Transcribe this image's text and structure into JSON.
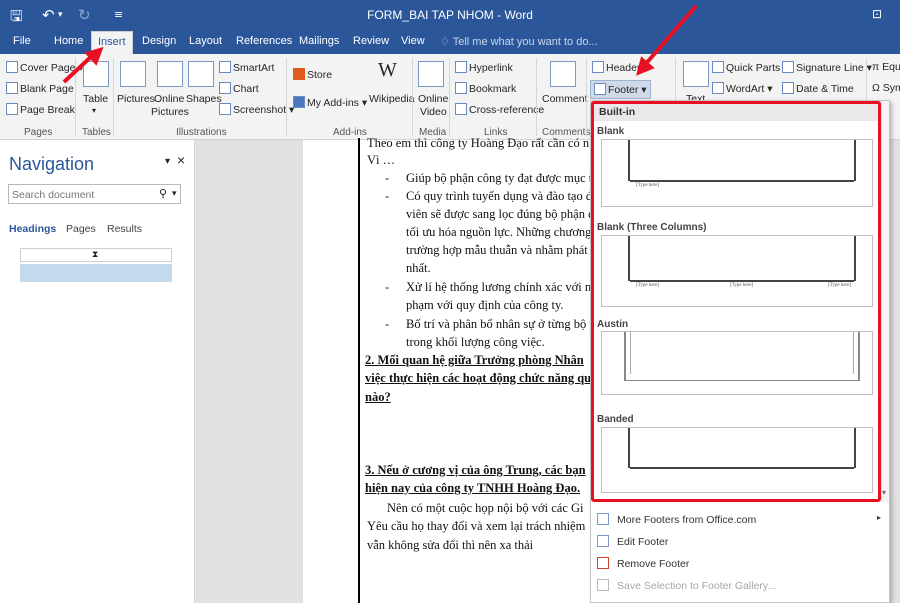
{
  "window": {
    "title": "FORM_BAI TAP NHOM - Word"
  },
  "ribbon_tabs": [
    "File",
    "Home",
    "Insert",
    "Design",
    "Layout",
    "References",
    "Mailings",
    "Review",
    "View"
  ],
  "tell_me": "Tell me what you want to do...",
  "ribbon": {
    "pages": {
      "cover_page": "Cover Page",
      "blank_page": "Blank Page",
      "page_break": "Page Break",
      "group": "Pages"
    },
    "tables": {
      "table": "Table",
      "group": "Tables"
    },
    "illustrations": {
      "pictures": "Pictures",
      "online_pictures_1": "Online",
      "online_pictures_2": "Pictures",
      "shapes": "Shapes",
      "smartart": "SmartArt",
      "chart": "Chart",
      "screenshot": "Screenshot",
      "group": "Illustrations"
    },
    "addins": {
      "store": "Store",
      "my_addins": "My Add-ins",
      "wikipedia": "Wikipedia",
      "group": "Add-ins"
    },
    "media": {
      "online_video_1": "Online",
      "online_video_2": "Video",
      "group": "Media"
    },
    "links": {
      "hyperlink": "Hyperlink",
      "bookmark": "Bookmark",
      "cross_reference": "Cross-reference",
      "group": "Links"
    },
    "comments": {
      "comment": "Comment",
      "group": "Comments"
    },
    "header_footer": {
      "header": "Header",
      "footer": "Footer"
    },
    "text": {
      "text_box": "Text",
      "quick_parts": "Quick Parts",
      "wordart": "WordArt",
      "signature_line": "Signature Line",
      "date_time": "Date & Time"
    },
    "symbols": {
      "equation": "Equ",
      "symbol": "Sym"
    }
  },
  "navigation": {
    "title": "Navigation",
    "search_placeholder": "Search document",
    "tabs": [
      "Headings",
      "Pages",
      "Results"
    ]
  },
  "document": {
    "lines": [
      "Theo em thì công ty Hoàng Đạo rất cần có n",
      "Vì …",
      "Giúp bộ phận công ty đạt được mục ti",
      "Có quy trình tuyển dụng và đào tạo đ",
      "viên sẽ được sang lọc đúng bộ phận đ",
      "tối ưu hóa nguồn lực. Những chương",
      "trường hợp mẫu thuẫn và nhằm phát t",
      "nhất.",
      "Xử lí hệ thống lương chính xác với nă",
      "phạm với quy định của công ty.",
      "Bố trí và phân bổ nhân sự ở từng bộ p",
      "trong khối lượng công việc.",
      "2. Mối quan hệ giữa Trưởng phòng Nhân",
      "việc thực hiện các hoạt động chức năng qu",
      "nào?",
      "3. Nếu ở cương vị của ông Trung, các bạn",
      "hiện nay của công ty TNHH Hoàng Đạo.",
      "Nên có một cuộc họp nội bộ với các Gi",
      "Yêu cầu họ thay đổi và xem lại trách nhiệm",
      "vẫn không sửa đổi thì nên xa thải"
    ]
  },
  "footer_gallery": {
    "section": "Built-in",
    "items": [
      "Blank",
      "Blank (Three Columns)",
      "Austin",
      "Banded"
    ],
    "placeholder": "[Type here]"
  },
  "footer_menu": {
    "more": "More Footers from Office.com",
    "edit": "Edit Footer",
    "remove": "Remove Footer",
    "save": "Save Selection to Footer Gallery..."
  },
  "colors": {
    "accent": "#2b579a",
    "highlight": "#e81123"
  }
}
